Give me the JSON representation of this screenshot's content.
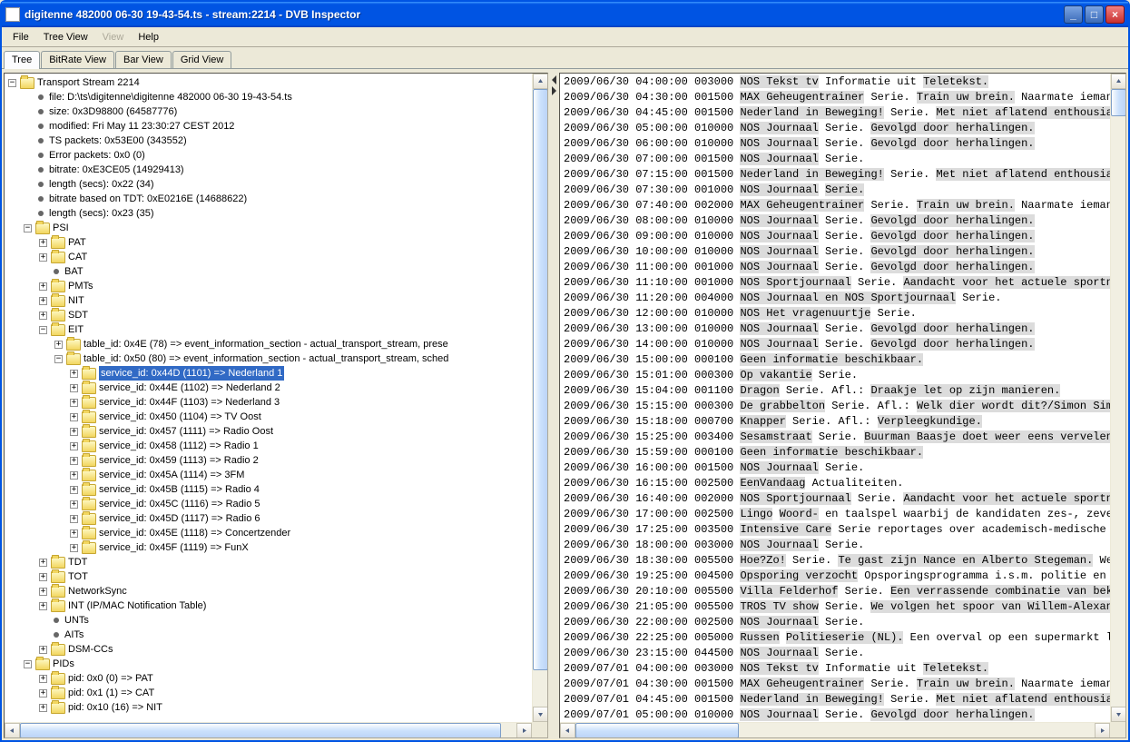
{
  "window": {
    "title": "digitenne 482000 06-30 19-43-54.ts - stream:2214 - DVB Inspector"
  },
  "menu": {
    "file": "File",
    "tree": "Tree View",
    "view": "View",
    "help": "Help"
  },
  "tabs": {
    "tree": "Tree",
    "bitrate": "BitRate View",
    "bar": "Bar View",
    "grid": "Grid View"
  },
  "tree": {
    "root": "Transport Stream 2214",
    "info": [
      "file: D:\\ts\\digitenne\\digitenne 482000 06-30 19-43-54.ts",
      "size: 0x3D98800 (64587776)",
      "modified: Fri May 11 23:30:27 CEST 2012",
      "TS packets: 0x53E00 (343552)",
      "Error packets: 0x0 (0)",
      "bitrate: 0xE3CE05 (14929413)",
      "length (secs): 0x22 (34)",
      "bitrate based on TDT: 0xE0216E (14688622)",
      "length (secs): 0x23 (35)"
    ],
    "psi": "PSI",
    "pat": "PAT",
    "cat": "CAT",
    "bat": "BAT",
    "pmts": "PMTs",
    "nit": "NIT",
    "sdt": "SDT",
    "eit": "EIT",
    "eit_t1": "table_id: 0x4E (78) => event_information_section - actual_transport_stream, prese",
    "eit_t2": "table_id: 0x50 (80) => event_information_section - actual_transport_stream, sched",
    "services": [
      "service_id: 0x44D (1101) => Nederland 1",
      "service_id: 0x44E (1102) => Nederland 2",
      "service_id: 0x44F (1103) => Nederland 3",
      "service_id: 0x450 (1104) => TV Oost",
      "service_id: 0x457 (1111) => Radio Oost",
      "service_id: 0x458 (1112) => Radio 1",
      "service_id: 0x459 (1113) => Radio 2",
      "service_id: 0x45A (1114) => 3FM",
      "service_id: 0x45B (1115) => Radio 4",
      "service_id: 0x45C (1116) => Radio 5",
      "service_id: 0x45D (1117) => Radio 6",
      "service_id: 0x45E (1118) => Concertzender",
      "service_id: 0x45F (1119) => FunX"
    ],
    "tdt": "TDT",
    "tot": "TOT",
    "nsync": "NetworkSync",
    "int": "INT (IP/MAC Notification Table)",
    "unts": "UNTs",
    "aits": "AITs",
    "dsmcc": "DSM-CCs",
    "pids": "PIDs",
    "pid0": "pid: 0x0 (0) => PAT",
    "pid1": "pid: 0x1 (1) => CAT",
    "pid2": "pid: 0x10 (16) => NIT"
  },
  "events": [
    {
      "ts": "2009/06/30 04:00:00 003000",
      "hl": [
        "NOS Tekst tv"
      ],
      "txt": " Informatie uit ",
      "hl2": [
        "Teletekst."
      ]
    },
    {
      "ts": "2009/06/30 04:30:00 001500",
      "hl": [
        "MAX Geheugentrainer"
      ],
      "txt": " Serie. ",
      "hl2": [
        "Train uw brein."
      ],
      "txt2": " Naarmate ieman"
    },
    {
      "ts": "2009/06/30 04:45:00 001500",
      "hl": [
        "Nederland in Beweging!"
      ],
      "txt": " Serie. ",
      "hl2": [
        "Met niet aflatend enthousia"
      ]
    },
    {
      "ts": "2009/06/30 05:00:00 010000",
      "hl": [
        "NOS Journaal"
      ],
      "txt": " Serie. ",
      "hl2": [
        "Gevolgd door herhalingen."
      ]
    },
    {
      "ts": "2009/06/30 06:00:00 010000",
      "hl": [
        "NOS Journaal"
      ],
      "txt": " Serie. ",
      "hl2": [
        "Gevolgd door herhalingen."
      ]
    },
    {
      "ts": "2009/06/30 07:00:00 001500",
      "hl": [
        "NOS Journaal"
      ],
      "txt": " Serie."
    },
    {
      "ts": "2009/06/30 07:15:00 001500",
      "hl": [
        "Nederland in Beweging!"
      ],
      "txt": " Serie. ",
      "hl2": [
        "Met niet aflatend enthousia"
      ]
    },
    {
      "ts": "2009/06/30 07:30:00 001000",
      "hl": [
        "NOS Journaal"
      ],
      "txt": " ",
      "hl2": [
        "Serie."
      ]
    },
    {
      "ts": "2009/06/30 07:40:00 002000",
      "hl": [
        "MAX Geheugentrainer"
      ],
      "txt": " Serie. ",
      "hl2": [
        "Train uw brein."
      ],
      "txt2": " Naarmate ieman"
    },
    {
      "ts": "2009/06/30 08:00:00 010000",
      "hl": [
        "NOS Journaal"
      ],
      "txt": " Serie. ",
      "hl2": [
        "Gevolgd door herhalingen."
      ]
    },
    {
      "ts": "2009/06/30 09:00:00 010000",
      "hl": [
        "NOS Journaal"
      ],
      "txt": " Serie. ",
      "hl2": [
        "Gevolgd door herhalingen."
      ]
    },
    {
      "ts": "2009/06/30 10:00:00 010000",
      "hl": [
        "NOS Journaal"
      ],
      "txt": " Serie. ",
      "hl2": [
        "Gevolgd door herhalingen."
      ]
    },
    {
      "ts": "2009/06/30 11:00:00 001000",
      "hl": [
        "NOS Journaal"
      ],
      "txt": " Serie. ",
      "hl2": [
        "Gevolgd door herhalingen."
      ]
    },
    {
      "ts": "2009/06/30 11:10:00 001000",
      "hl": [
        "NOS Sportjournaal"
      ],
      "txt": " Serie. ",
      "hl2": [
        "Aandacht voor het actuele sportn"
      ]
    },
    {
      "ts": "2009/06/30 11:20:00 004000",
      "hl": [
        "NOS Journaal en NOS Sportjournaal"
      ],
      "txt": " Serie."
    },
    {
      "ts": "2009/06/30 12:00:00 010000",
      "hl": [
        "NOS Het vragenuurtje"
      ],
      "txt": " Serie."
    },
    {
      "ts": "2009/06/30 13:00:00 010000",
      "hl": [
        "NOS Journaal"
      ],
      "txt": " Serie. ",
      "hl2": [
        "Gevolgd door herhalingen."
      ]
    },
    {
      "ts": "2009/06/30 14:00:00 010000",
      "hl": [
        "NOS Journaal"
      ],
      "txt": " Serie. ",
      "hl2": [
        "Gevolgd door herhalingen."
      ]
    },
    {
      "ts": "2009/06/30 15:00:00 000100",
      "hl": [
        "Geen informatie beschikbaar."
      ]
    },
    {
      "ts": "2009/06/30 15:01:00 000300",
      "hl": [
        "Op vakantie"
      ],
      "txt": " Serie."
    },
    {
      "ts": "2009/06/30 15:04:00 001100",
      "hl": [
        "Dragon"
      ],
      "txt": " Serie. Afl.: ",
      "hl2": [
        "Draakje let op zijn manieren."
      ]
    },
    {
      "ts": "2009/06/30 15:15:00 000300",
      "hl": [
        "De grabbelton"
      ],
      "txt": " Serie. Afl.: ",
      "hl2": [
        "Welk dier wordt dit?/Simon Sim"
      ]
    },
    {
      "ts": "2009/06/30 15:18:00 000700",
      "hl": [
        "Knapper"
      ],
      "txt": " Serie. Afl.: ",
      "hl2": [
        "Verpleegkundige."
      ]
    },
    {
      "ts": "2009/06/30 15:25:00 003400",
      "hl": [
        "Sesamstraat"
      ],
      "txt": " Serie. ",
      "hl2": [
        "Buurman Baasje doet weer eens vervelen"
      ]
    },
    {
      "ts": "2009/06/30 15:59:00 000100",
      "hl": [
        "Geen informatie beschikbaar."
      ]
    },
    {
      "ts": "2009/06/30 16:00:00 001500",
      "hl": [
        "NOS Journaal"
      ],
      "txt": " Serie."
    },
    {
      "ts": "2009/06/30 16:15:00 002500",
      "hl": [
        "EenVandaag"
      ],
      "txt": " Actualiteiten."
    },
    {
      "ts": "2009/06/30 16:40:00 002000",
      "hl": [
        "NOS Sportjournaal"
      ],
      "txt": " Serie. ",
      "hl2": [
        "Aandacht voor het actuele sportn"
      ]
    },
    {
      "ts": "2009/06/30 17:00:00 002500",
      "hl": [
        "Lingo"
      ],
      "txt": " ",
      "hl2": [
        "Woord-"
      ],
      "txt2": " en taalspel waarbij de kandidaten zes-, zeve"
    },
    {
      "ts": "2009/06/30 17:25:00 003500",
      "hl": [
        "Intensive Care"
      ],
      "txt": " Serie reportages over academisch-medische "
    },
    {
      "ts": "2009/06/30 18:00:00 003000",
      "hl": [
        "NOS Journaal"
      ],
      "txt": " Serie."
    },
    {
      "ts": "2009/06/30 18:30:00 005500",
      "hl": [
        "Hoe?Zo!"
      ],
      "txt": " Serie. ",
      "hl2": [
        "Te gast zijn Nance en Alberto Stegeman."
      ],
      "txt2": " We"
    },
    {
      "ts": "2009/06/30 19:25:00 004500",
      "hl": [
        "Opsporing verzocht"
      ],
      "txt": " Opsporingsprogramma i.s.m. politie en "
    },
    {
      "ts": "2009/06/30 20:10:00 005500",
      "hl": [
        "Villa Felderhof"
      ],
      "txt": " Serie. ",
      "hl2": [
        "Een verrassende combinatie van bek"
      ]
    },
    {
      "ts": "2009/06/30 21:05:00 005500",
      "hl": [
        "TROS TV show"
      ],
      "txt": " Serie. ",
      "hl2": [
        "We volgen het spoor van Willem-Alexan"
      ]
    },
    {
      "ts": "2009/06/30 22:00:00 002500",
      "hl": [
        "NOS Journaal"
      ],
      "txt": " Serie."
    },
    {
      "ts": "2009/06/30 22:25:00 005000",
      "hl": [
        "Russen"
      ],
      "txt": " ",
      "hl2": [
        "Politieserie (NL)."
      ],
      "txt2": " Een overval op een supermarkt l"
    },
    {
      "ts": "2009/06/30 23:15:00 044500",
      "hl": [
        "NOS Journaal"
      ],
      "txt": " Serie."
    },
    {
      "ts": "2009/07/01 04:00:00 003000",
      "hl": [
        "NOS Tekst tv"
      ],
      "txt": " Informatie uit ",
      "hl2": [
        "Teletekst."
      ]
    },
    {
      "ts": "2009/07/01 04:30:00 001500",
      "hl": [
        "MAX Geheugentrainer"
      ],
      "txt": " Serie. ",
      "hl2": [
        "Train uw brein."
      ],
      "txt2": " Naarmate ieman"
    },
    {
      "ts": "2009/07/01 04:45:00 001500",
      "hl": [
        "Nederland in Beweging!"
      ],
      "txt": " Serie. ",
      "hl2": [
        "Met niet aflatend enthousia"
      ]
    },
    {
      "ts": "2009/07/01 05:00:00 010000",
      "hl": [
        "NOS Journaal"
      ],
      "txt": " Serie. ",
      "hl2": [
        "Gevolgd door herhalingen."
      ]
    }
  ]
}
